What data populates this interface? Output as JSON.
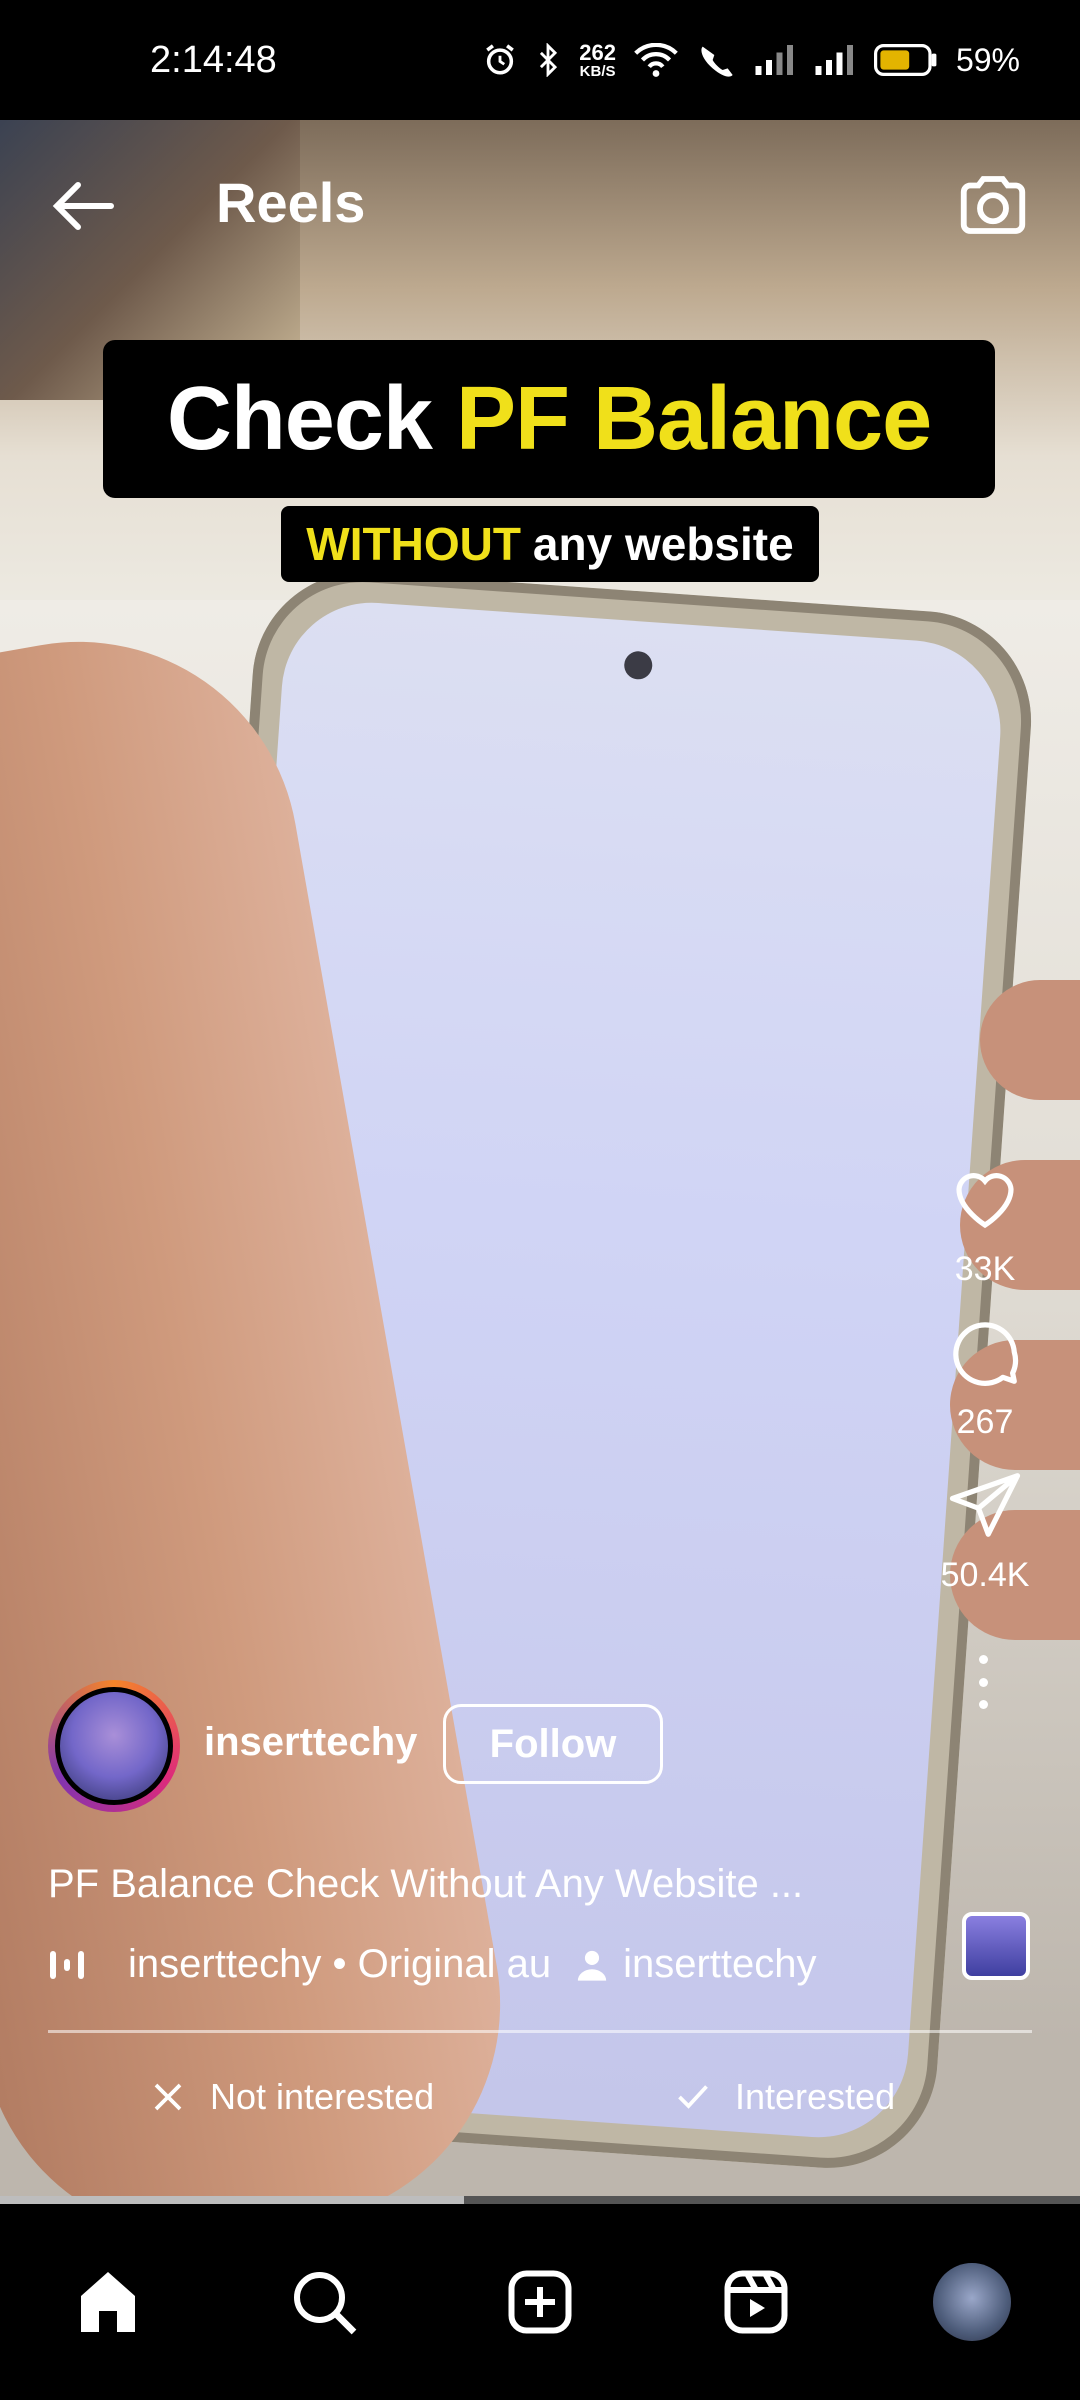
{
  "status_bar": {
    "time": "2:14:48",
    "speed": "262",
    "speed_unit": "KB/S",
    "battery": "59%"
  },
  "top_bar": {
    "title": "Reels"
  },
  "video_caption": {
    "line1_white": "Check",
    "line1_yellow": "PF Balance",
    "line2_yellow": "WITHOUT",
    "line2_white": "any website"
  },
  "actions": {
    "likes": "33K",
    "comments": "267",
    "shares": "50.4K"
  },
  "author": {
    "username": "inserttechy",
    "follow_label": "Follow"
  },
  "description": "PF Balance Check Without Any Website ...",
  "audio": {
    "text": "inserttechy • Original au",
    "tagged_user": "inserttechy"
  },
  "feedback": {
    "not_interested": "Not interested",
    "interested": "Interested"
  },
  "progress": 0.43,
  "nav": [
    "home-icon",
    "search-icon",
    "create-icon",
    "reels-icon",
    "profile-avatar"
  ]
}
